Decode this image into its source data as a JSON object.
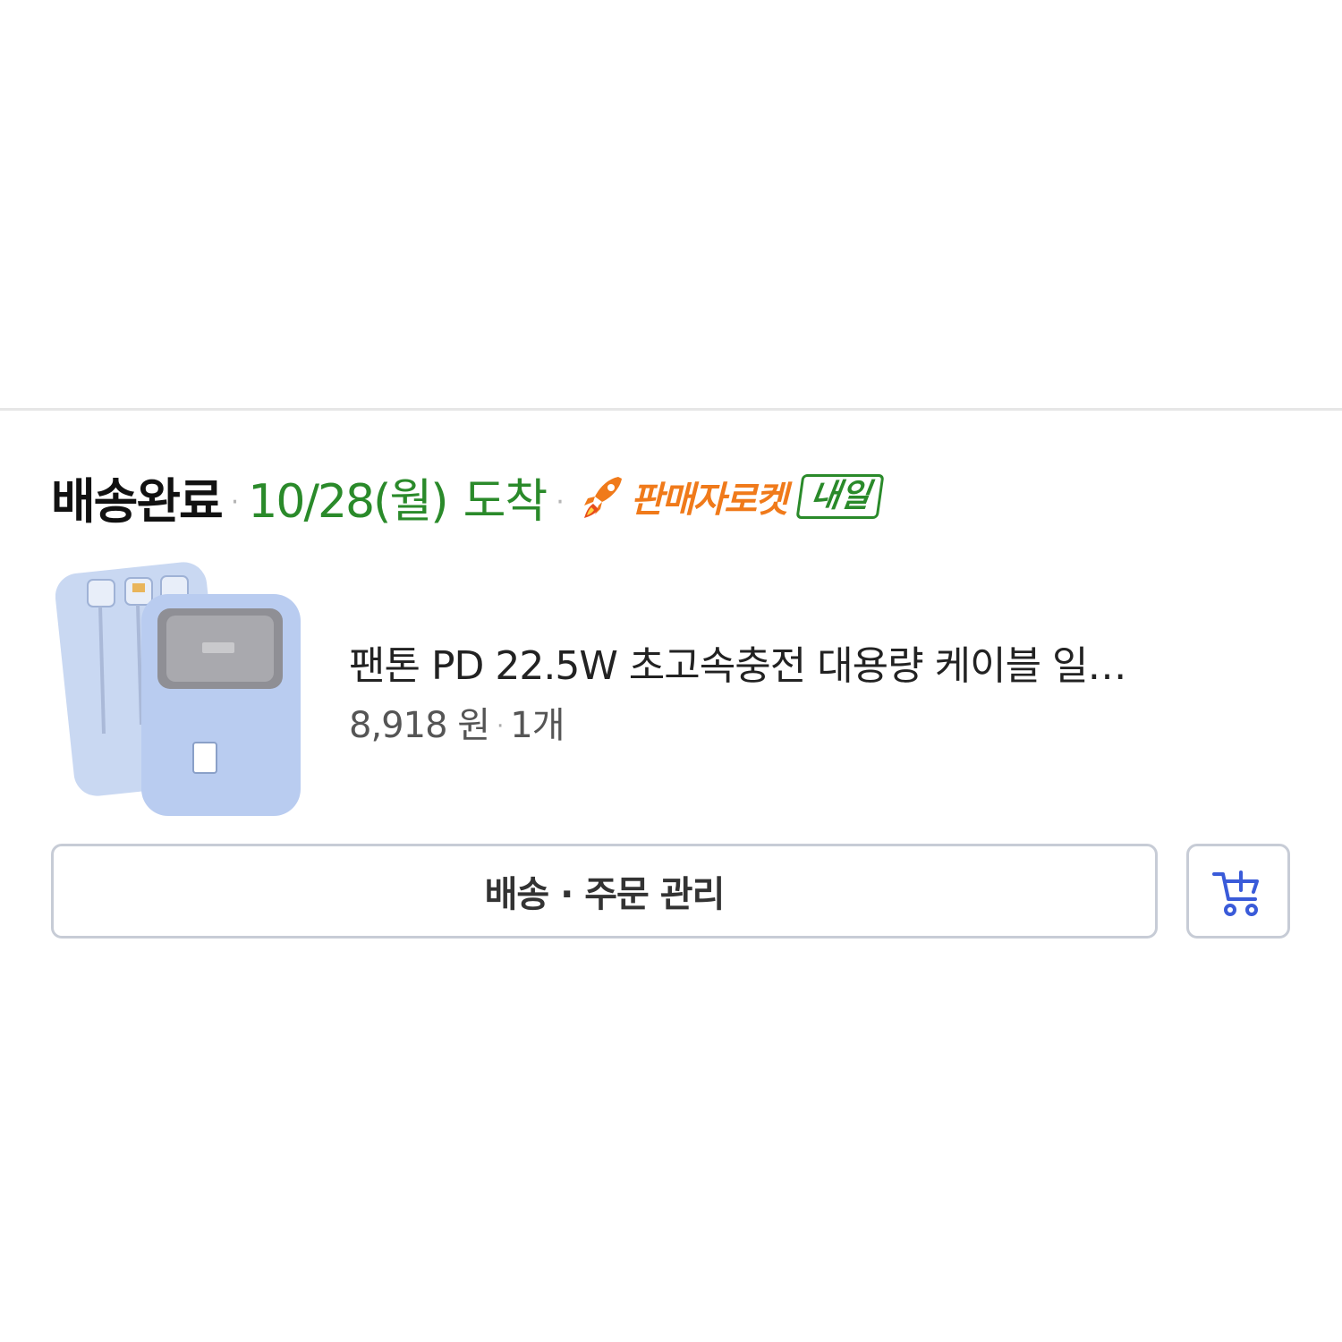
{
  "order": {
    "status": "배송완료",
    "separator": "·",
    "arrival_date": "10/28(월)",
    "arrival_suffix": "도착",
    "delivery_badge": "판매자로켓",
    "delivery_tag": "내일"
  },
  "product": {
    "title": "팬톤 PD 22.5W 초고속충전 대용량 케이블 일…",
    "price": "8,918 원",
    "quantity": "1개",
    "image_icon": "power-bank-image"
  },
  "actions": {
    "manage_label": "배송 · 주문 관리",
    "cart_icon": "add-to-cart-icon"
  },
  "colors": {
    "status_text": "#111111",
    "arrival_green": "#2a8a2a",
    "rocket_orange": "#f07a1a",
    "cart_blue": "#3a5bd9",
    "button_border": "#c7ccd6"
  }
}
